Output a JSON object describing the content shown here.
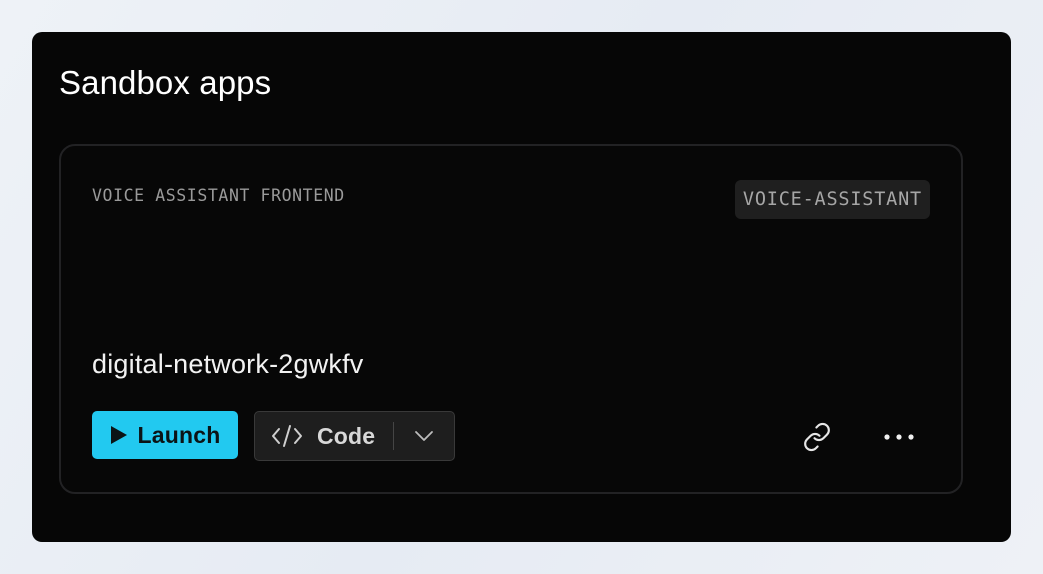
{
  "panel": {
    "title": "Sandbox apps"
  },
  "card": {
    "subtitle": "VOICE ASSISTANT FRONTEND",
    "tag": "VOICE-ASSISTANT",
    "app_name": "digital-network-2gwkfv",
    "actions": {
      "launch_label": "Launch",
      "code_label": "Code",
      "launch_icon": "play-icon",
      "code_icon": "code-brackets-icon",
      "dropdown_icon": "chevron-down-icon",
      "link_icon": "link-icon",
      "more_icon": "more-horizontal-icon"
    }
  },
  "colors": {
    "accent": "#22c9f0",
    "panel_background": "#060606",
    "card_border": "#222224"
  }
}
